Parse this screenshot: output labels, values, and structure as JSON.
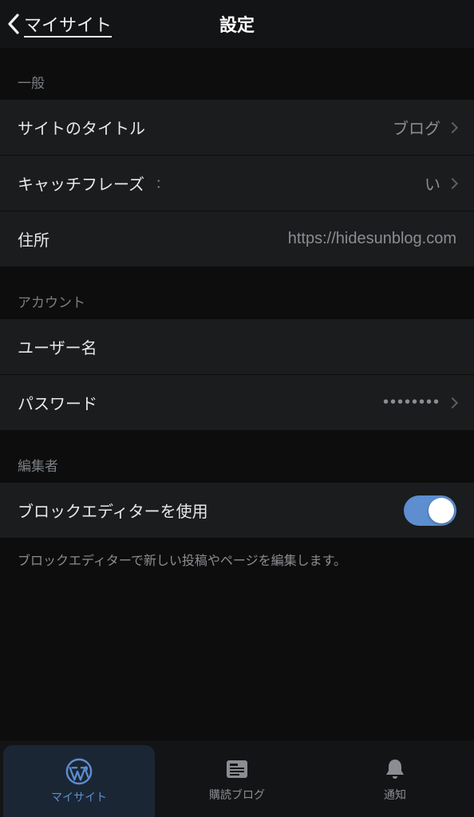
{
  "nav": {
    "back_label": "マイサイト",
    "title": "設定"
  },
  "sections": {
    "general": {
      "header": "一般",
      "site_title_label": "サイトのタイトル",
      "site_title_value": "ブログ",
      "tagline_label": "キャッチフレーズ",
      "tagline_hint": "：",
      "tagline_value": "い",
      "address_label": "住所",
      "address_value": "https://hidesunblog.com"
    },
    "account": {
      "header": "アカウント",
      "username_label": "ユーザー名",
      "password_label": "パスワード",
      "password_value": "••••••••"
    },
    "editor": {
      "header": "編集者",
      "block_editor_label": "ブロックエディターを使用",
      "block_editor_on": true,
      "footnote": "ブロックエディターで新しい投稿やページを編集します。"
    }
  },
  "tabs": {
    "mysite": "マイサイト",
    "reader": "購読ブログ",
    "notifications": "通知"
  },
  "colors": {
    "accent": "#5d8ecf"
  }
}
